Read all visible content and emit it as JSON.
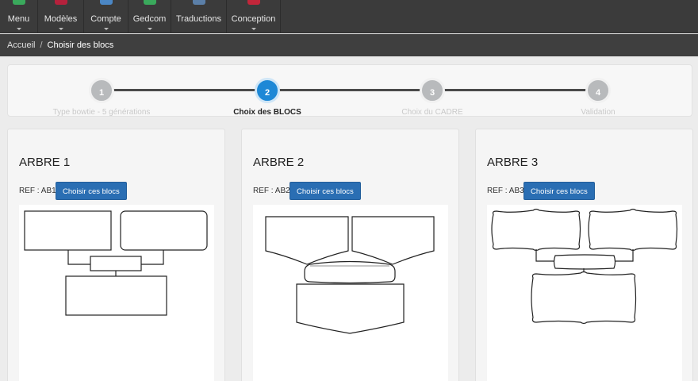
{
  "nav": {
    "items": [
      {
        "label": "Menu",
        "icon": "list-icon",
        "color": "#3aa95c"
      },
      {
        "label": "Modèles",
        "icon": "folder-icon",
        "color": "#b5213c"
      },
      {
        "label": "Compte",
        "icon": "user-icon",
        "color": "#4b87c5"
      },
      {
        "label": "Gedcom",
        "icon": "database-icon",
        "color": "#3aa95c"
      },
      {
        "label": "Traductions",
        "icon": "flag-icon",
        "color": "#5b7fa8"
      },
      {
        "label": "Conception",
        "icon": "brush-icon",
        "color": "#c2263a"
      }
    ]
  },
  "breadcrumb": {
    "home": "Accueil",
    "separator": "/",
    "current": "Choisir des blocs"
  },
  "wizard": {
    "steps": [
      {
        "number": "1",
        "label": "Type bowtie - 5 générations",
        "state": "done"
      },
      {
        "number": "2",
        "label": "Choix des BLOCS",
        "state": "active"
      },
      {
        "number": "3",
        "label": "Choix du CADRE",
        "state": "todo"
      },
      {
        "number": "4",
        "label": "Validation",
        "state": "todo"
      }
    ],
    "active_color": "#1e88d6",
    "inactive_color": "#b8babc"
  },
  "cards": [
    {
      "title": "ARBRE 1",
      "ref": "REF : AB1",
      "button": "Choisir ces blocs",
      "style": "rectangles"
    },
    {
      "title": "ARBRE 2",
      "ref": "REF : AB2",
      "button": "Choisir ces blocs",
      "style": "shields"
    },
    {
      "title": "ARBRE 3",
      "ref": "REF : AB3",
      "button": "Choisir ces blocs",
      "style": "ornate-frames"
    }
  ],
  "colors": {
    "button": "#2a6eb3",
    "topbar": "#3b3b3b"
  }
}
